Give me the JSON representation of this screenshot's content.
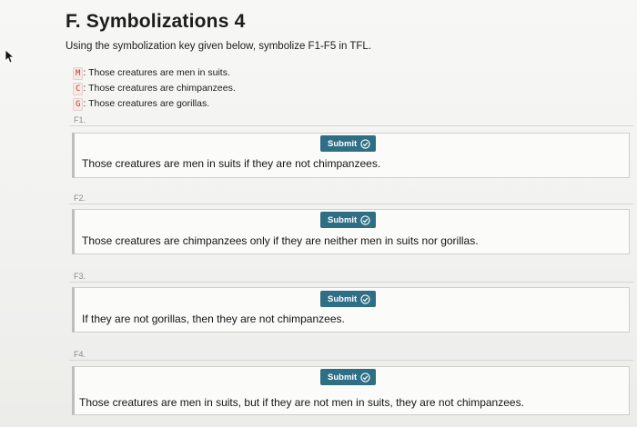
{
  "header": {
    "title": "F. Symbolizations 4",
    "instructions": "Using the symbolization key given below, symbolize F1-F5 in TFL."
  },
  "key": [
    {
      "letter": "M",
      "meaning": ": Those creatures are men in suits."
    },
    {
      "letter": "C",
      "meaning": ": Those creatures are chimpanzees."
    },
    {
      "letter": "G",
      "meaning": ": Those creatures are gorillas."
    }
  ],
  "questions": [
    {
      "label": "F1.",
      "submit_label": "Submit",
      "prompt": "Those creatures are men in suits if they are not chimpanzees."
    },
    {
      "label": "F2.",
      "submit_label": "Submit",
      "prompt": "Those creatures are chimpanzees only if they are neither men in suits nor gorillas."
    },
    {
      "label": "F3.",
      "submit_label": "Submit",
      "prompt": "If they are not gorillas, then they are not chimpanzees."
    },
    {
      "label": "F4.",
      "submit_label": "Submit",
      "prompt": "Those creatures are men in suits, but if they are not men in suits, they are not chimpanzees."
    }
  ],
  "colors": {
    "submit_bg": "#2f6f86",
    "key_letter": "#c0392b"
  },
  "icons": {
    "submit": "check-circle-icon",
    "cursor": "mouse-pointer-icon"
  }
}
